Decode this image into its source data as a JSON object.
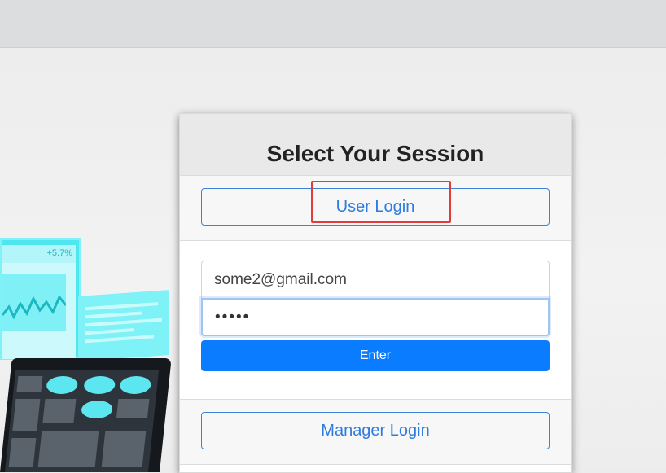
{
  "card": {
    "title": "Select Your Session",
    "user_login_label": "User Login",
    "email_value": "some2@gmail.com",
    "password_mask": "•••••",
    "enter_label": "Enter",
    "manager_login_label": "Manager Login"
  },
  "illustration": {
    "percent_label": "+5.7%"
  },
  "colors": {
    "primary": "#0a7cff",
    "outline": "#3b84d9",
    "highlight": "#e33b3b",
    "accent_cyan": "#4fe7ef"
  }
}
